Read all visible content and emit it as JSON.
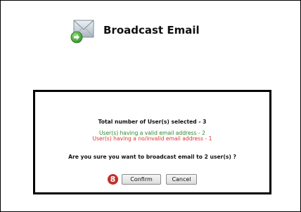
{
  "header": {
    "title": "Broadcast Email",
    "icon": "envelope-arrow-icon"
  },
  "dialog": {
    "total_text": "Total number of User(s) selected - 3",
    "valid_text": "User(s) having a valid email address - 2",
    "invalid_text": "User(s) having a no/invalid email address - 1",
    "question_text": "Are you sure you want to broadcast email to 2 user(s) ?",
    "step_badge": "8",
    "confirm_label": "Confirm",
    "cancel_label": "Cancel"
  },
  "colors": {
    "valid": "#2b8a2b",
    "invalid": "#e23232",
    "badge": "#c0302c"
  }
}
